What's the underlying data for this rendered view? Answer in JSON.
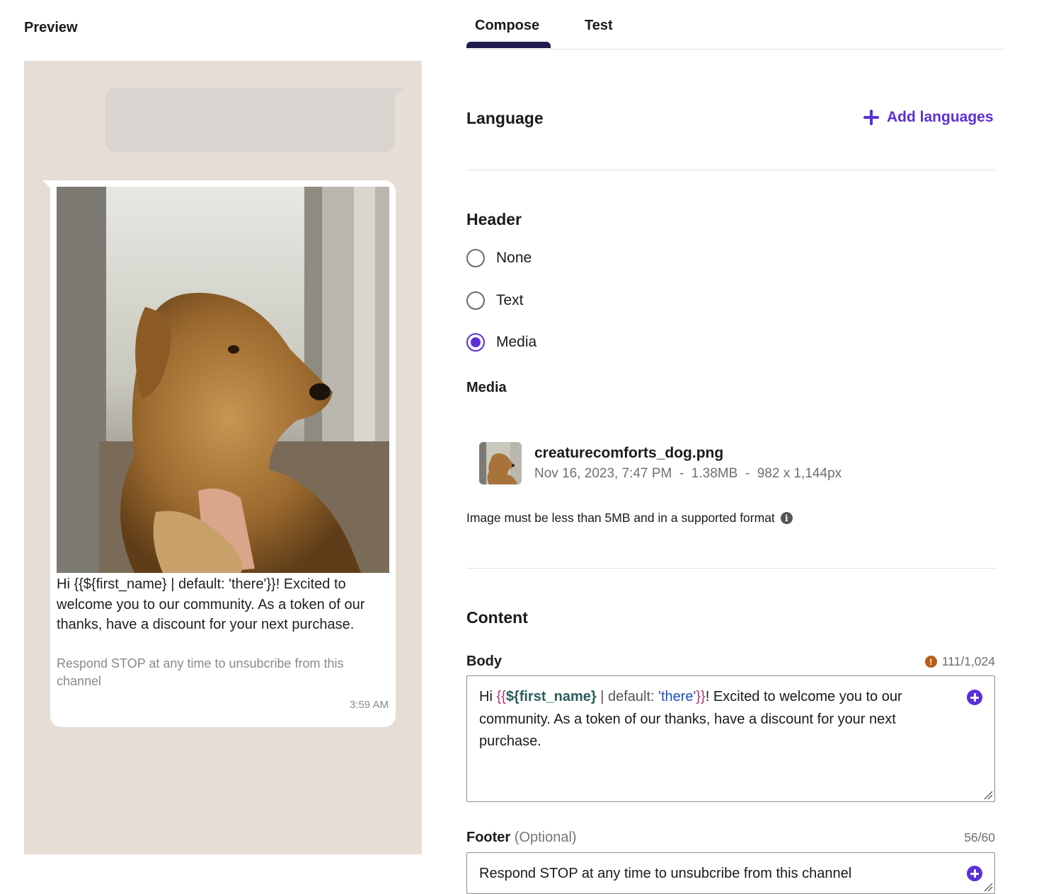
{
  "preview": {
    "title": "Preview",
    "message": {
      "body": "Hi {{${first_name} | default: 'there'}}! Excited to welcome you to our community. As a token of our thanks, have a discount for your next purchase.",
      "footer": "Respond STOP at any time to unsubcribe from this channel",
      "time": "3:59 AM",
      "image_icon": "dog-photo"
    }
  },
  "tabs": [
    {
      "label": "Compose",
      "active": true
    },
    {
      "label": "Test",
      "active": false
    }
  ],
  "language": {
    "title": "Language",
    "add_label": "Add languages",
    "add_icon": "plus-icon"
  },
  "header": {
    "title": "Header",
    "options": [
      {
        "label": "None",
        "checked": false
      },
      {
        "label": "Text",
        "checked": false
      },
      {
        "label": "Media",
        "checked": true
      }
    ],
    "media_label": "Media",
    "file": {
      "name": "creaturecomforts_dog.png",
      "date": "Nov 16, 2023, 7:47 PM",
      "size": "1.38MB",
      "dimensions": "982 x 1,144px"
    },
    "hint": "Image must be less than 5MB and in a supported format"
  },
  "content": {
    "title": "Content",
    "body_label": "Body",
    "body_counter": "111/1,024",
    "body_tokens": {
      "prefix": "Hi ",
      "open_brace": "{{",
      "variable": "${first_name}",
      "separator": " | default: ",
      "default_value": "'there'",
      "close_brace": "}}",
      "suffix": "! Excited to welcome you to our community. As a token of our thanks, have a discount for your next purchase."
    },
    "footer_label": "Footer",
    "footer_optional": "(Optional)",
    "footer_counter": "56/60",
    "footer_value": "Respond STOP at any time to unsubcribe from this channel"
  },
  "colors": {
    "accent": "#5b2fd8",
    "tab_underline": "#1f1b4d",
    "preview_bg": "#e6ddd5",
    "warning": "#b85c1a"
  }
}
